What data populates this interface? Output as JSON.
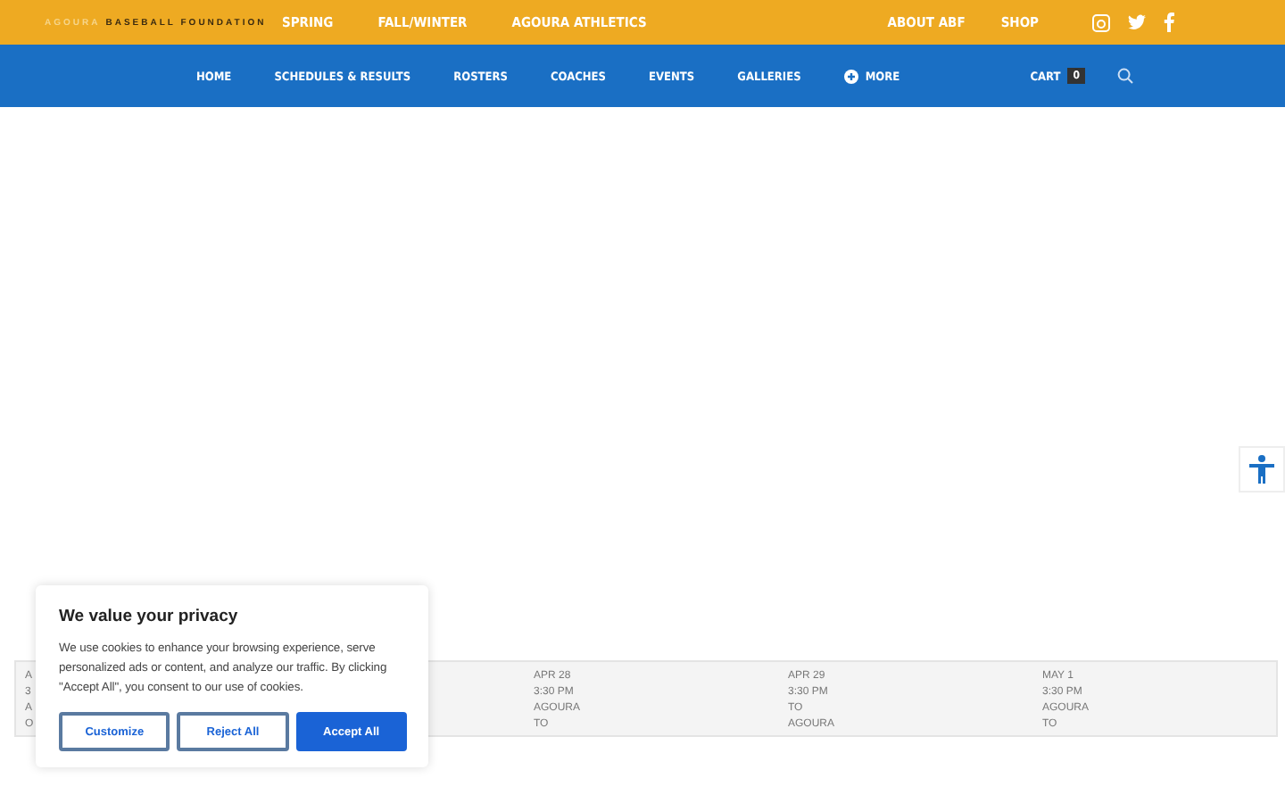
{
  "logo": {
    "part_1": "AGOURA",
    "part_2": "BASEBALL FOUNDATION"
  },
  "top_links": [
    "SPRING",
    "FALL/WINTER",
    "AGOURA ATHLETICS"
  ],
  "top_right_links": [
    "ABOUT ABF",
    "SHOP"
  ],
  "nav_items": [
    {
      "label": "HOME",
      "kind": "link"
    },
    {
      "label": "SCHEDULES & RESULTS",
      "kind": "link"
    },
    {
      "label": "ROSTERS",
      "kind": "link"
    },
    {
      "label": "COACHES",
      "kind": "link"
    },
    {
      "label": "EVENTS",
      "kind": "link"
    },
    {
      "label": "GALLERIES",
      "kind": "link"
    },
    {
      "label": "MORE",
      "kind": "more"
    }
  ],
  "cart": {
    "label": "CART",
    "count": "0"
  },
  "schedule": [
    [
      "A",
      "3",
      "A",
      "O"
    ],
    [
      "APR 28",
      "3:30 PM",
      "AGOURA",
      "TO"
    ],
    [
      "APR 29",
      "3:30 PM",
      "TO",
      "AGOURA"
    ],
    [
      "MAY 1",
      "3:30 PM",
      "AGOURA",
      "TO"
    ]
  ],
  "cookie_banner": {
    "title": "We value your privacy",
    "text": "We use cookies to enhance your browsing experience, serve personalized ads or content, and analyze our traffic. By clicking \"Accept All\", you consent to our use of cookies.",
    "buttons": [
      {
        "label": "Customize",
        "kind": "outline"
      },
      {
        "label": "Reject All",
        "kind": "outline"
      },
      {
        "label": "Accept All",
        "kind": "primary"
      }
    ]
  }
}
